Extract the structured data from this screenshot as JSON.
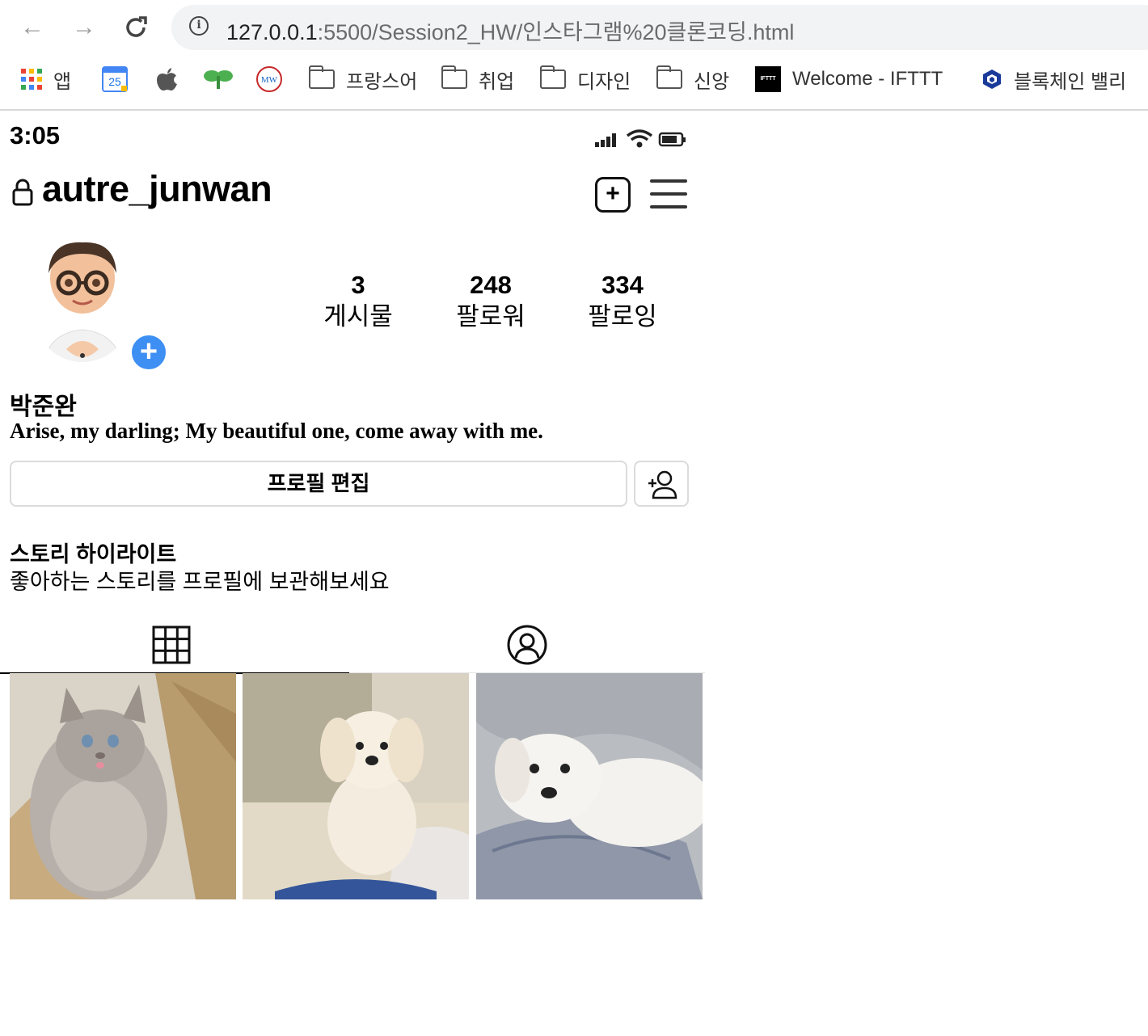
{
  "browser": {
    "url_host": "127.0.0.1",
    "url_path": ":5500/Session2_HW/인스타그램%20클론코딩.html",
    "bookmarks": [
      {
        "label": "앱",
        "icon": "apps-grid-icon"
      },
      {
        "label": "",
        "icon": "calendar-icon",
        "badge": "25"
      },
      {
        "label": "",
        "icon": "apple-icon"
      },
      {
        "label": "",
        "icon": "sprout-icon"
      },
      {
        "label": "",
        "icon": "mw-dictionary-icon",
        "badge": "MW"
      },
      {
        "label": "프랑스어",
        "icon": "folder-icon"
      },
      {
        "label": "취업",
        "icon": "folder-icon"
      },
      {
        "label": "디자인",
        "icon": "folder-icon"
      },
      {
        "label": "신앙",
        "icon": "folder-icon"
      },
      {
        "label": "Welcome - IFTTT",
        "icon": "ifttt-icon",
        "badge": "IFTTT"
      },
      {
        "label": "블록체인 밸리",
        "icon": "blockchain-icon"
      }
    ]
  },
  "status_bar": {
    "time": "3:05"
  },
  "profile": {
    "username": "autre_junwan",
    "name": "박준완",
    "bio": "Arise, my darling; My beautiful one, come away with me.",
    "stats": [
      {
        "value": "3",
        "label": "게시물"
      },
      {
        "value": "248",
        "label": "팔로워"
      },
      {
        "value": "334",
        "label": "팔로잉"
      }
    ],
    "edit_button": "프로필 편집"
  },
  "highlights": {
    "title": "스토리 하이라이트",
    "subtitle": "좋아하는 스토리를 프로필에 보관해보세요"
  },
  "tabs": [
    {
      "icon": "grid-icon",
      "active": true
    },
    {
      "icon": "tagged-user-icon",
      "active": false
    }
  ],
  "posts": [
    {
      "subject": "gray cat in cardboard box"
    },
    {
      "subject": "white fluffy puppy sitting"
    },
    {
      "subject": "white puppy lying on pillow"
    }
  ],
  "colors": {
    "accent_blue": "#3d8ff3",
    "border": "#dbdbdb"
  }
}
